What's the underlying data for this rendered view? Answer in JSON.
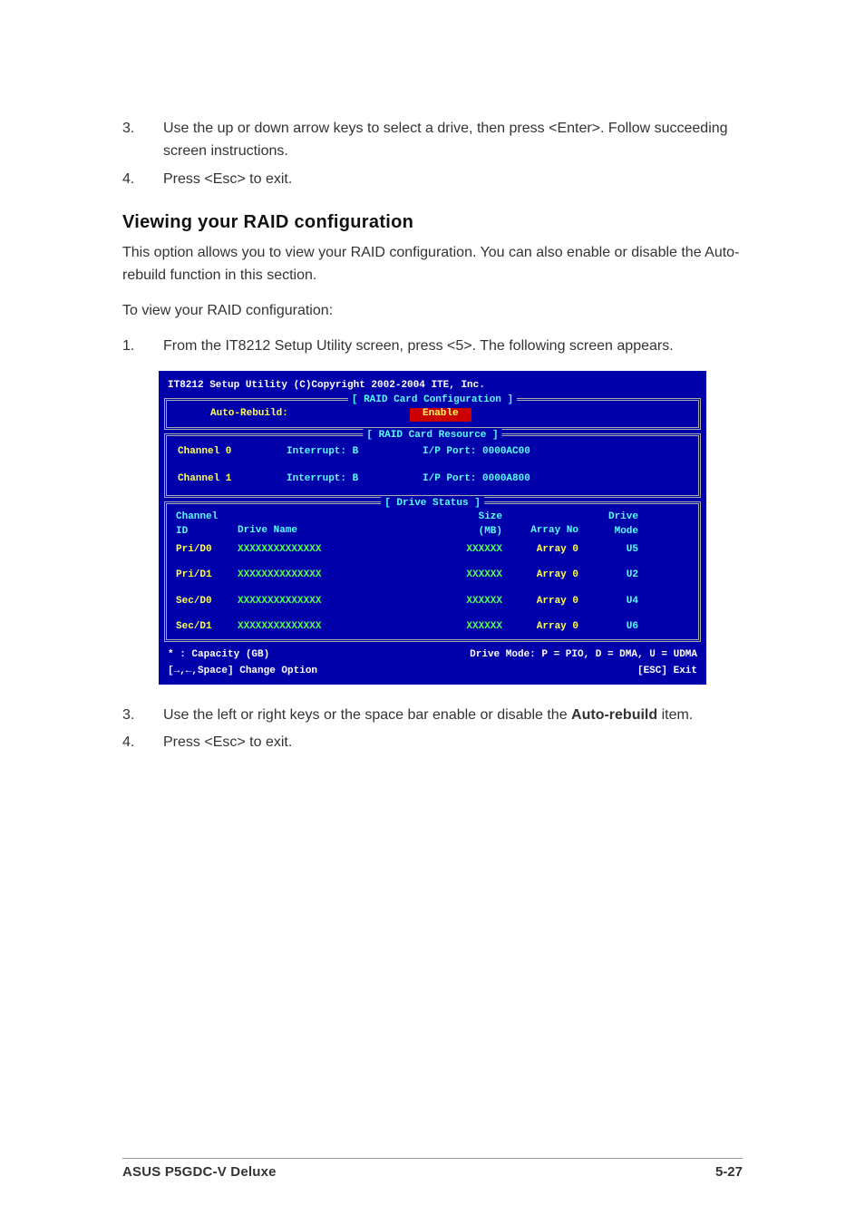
{
  "steps_top": [
    {
      "num": "3.",
      "text": "Use the up or down arrow keys to select a drive, then press <Enter>. Follow succeeding screen instructions."
    },
    {
      "num": "4.",
      "text": "Press <Esc> to exit."
    }
  ],
  "heading": "Viewing your RAID configuration",
  "para1": "This option allows you to view your RAID configuration. You can also enable or disable the Auto-rebuild function in this section.",
  "para2": "To view your RAID configuration:",
  "step1": {
    "num": "1.",
    "text": "From the IT8212 Setup Utility screen, press <5>. The following screen appears."
  },
  "bios": {
    "title": "IT8212 Setup Utility (C)Copyright 2002-2004 ITE, Inc.",
    "conf_legend": "[ RAID Card Configuration ]",
    "auto_label": "Auto-Rebuild:",
    "auto_value": "Enable",
    "res_legend": "[ RAID Card Resource ]",
    "ch0": {
      "label": "Channel 0",
      "int": "Interrupt: B",
      "ip": "I/P Port: 0000AC00"
    },
    "ch1": {
      "label": "Channel 1",
      "int": "Interrupt: B",
      "ip": "I/P Port: 0000A800"
    },
    "ds_legend": "[ Drive Status ]",
    "head": {
      "c1a": "Channel",
      "c1b": "ID",
      "c2": "Drive Name",
      "c3a": "Size",
      "c3b": "(MB)",
      "c4": "Array No",
      "c5a": "Drive",
      "c5b": "Mode"
    },
    "rows": [
      {
        "id": "Pri/D0",
        "name": "XXXXXXXXXXXXXX",
        "size": "XXXXXX",
        "array": "Array 0",
        "mode": "U5"
      },
      {
        "id": "Pri/D1",
        "name": "XXXXXXXXXXXXXX",
        "size": "XXXXXX",
        "array": "Array 0",
        "mode": "U2"
      },
      {
        "id": "Sec/D0",
        "name": "XXXXXXXXXXXXXX",
        "size": "XXXXXX",
        "array": "Array 0",
        "mode": "U4"
      },
      {
        "id": "Sec/D1",
        "name": "XXXXXXXXXXXXXX",
        "size": "XXXXXX",
        "array": "Array 0",
        "mode": "U6"
      }
    ],
    "foot_l1": "* : Capacity (GB)",
    "foot_r1": "Drive Mode: P = PIO, D = DMA, U = UDMA",
    "foot_l2": "[→,←,Space] Change Option",
    "foot_r2": "[ESC] Exit"
  },
  "steps_bottom": {
    "s3": {
      "num": "3.",
      "pre": "Use the left or right keys or the space bar enable or disable the ",
      "bold": "Auto-rebuild",
      "post": " item."
    },
    "s4": {
      "num": "4.",
      "text": "Press <Esc> to exit."
    }
  },
  "footer": {
    "model": "ASUS P5GDC-V Deluxe",
    "page": "5-27"
  }
}
